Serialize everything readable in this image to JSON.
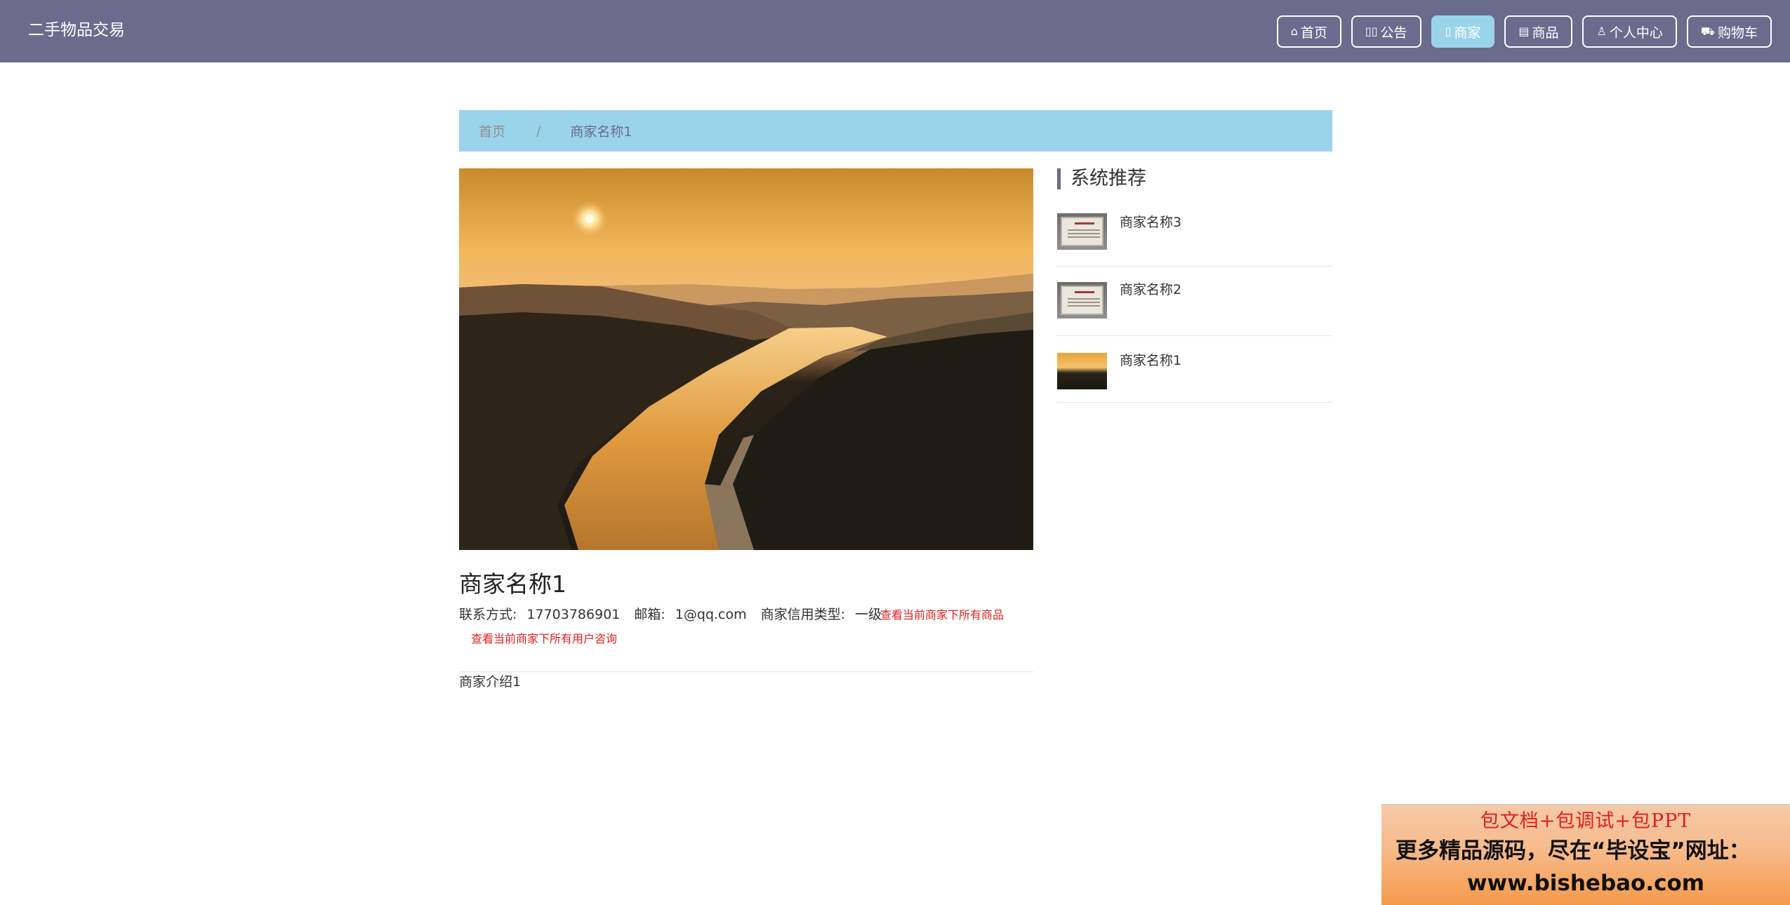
{
  "header": {
    "site_title": "二手物品交易",
    "nav": [
      {
        "label": "首页",
        "icon": "home-icon"
      },
      {
        "label": "公告",
        "icon": "announcement-icon"
      },
      {
        "label": "商家",
        "icon": "shop-icon",
        "active": true
      },
      {
        "label": "商品",
        "icon": "goods-icon"
      },
      {
        "label": "个人中心",
        "icon": "user-icon"
      },
      {
        "label": "购物车",
        "icon": "cart-icon"
      }
    ],
    "colors": {
      "bar": "#6b6b8e",
      "active": "#9ad4ea"
    }
  },
  "breadcrumb": {
    "home": "首页",
    "separator": "/",
    "current": "商家名称1"
  },
  "merchant": {
    "image": "river-canyon-sunset-photo",
    "name": "商家名称1",
    "contact_label": "联系方式:",
    "contact_value": "17703786901",
    "email_label": "邮箱:",
    "email_value": "1@qq.com",
    "credit_label": "商家信用类型:",
    "credit_value": "一级",
    "link_products": "查看当前商家下所有商品",
    "link_consult": "查看当前商家下所有用户咨询",
    "intro": "商家介绍1",
    "link_color": "#e0201e"
  },
  "recommend": {
    "heading": "系统推荐",
    "items": [
      {
        "name": "商家名称3",
        "thumb": "certificate-photo"
      },
      {
        "name": "商家名称2",
        "thumb": "certificate-photo"
      },
      {
        "name": "商家名称1",
        "thumb": "river-photo"
      }
    ]
  },
  "promo": {
    "line1": "包文档+包调试+包PPT",
    "line2": "更多精品源码，尽在“毕设宝”网址：",
    "line3": "www.bishebao.com"
  }
}
